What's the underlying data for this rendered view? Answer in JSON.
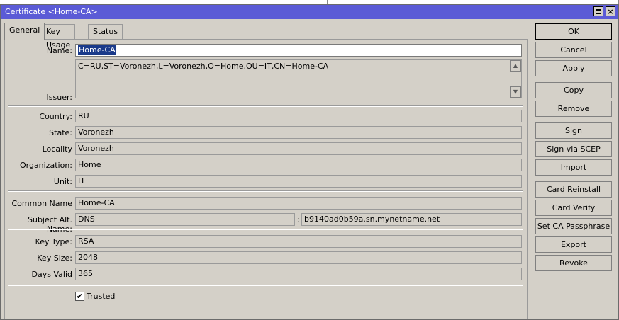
{
  "window": {
    "title": "Certificate <Home-CA>"
  },
  "tabs": [
    {
      "label": "General"
    },
    {
      "label": "Key Usage"
    },
    {
      "label": "Status"
    }
  ],
  "form": {
    "name": {
      "label": "Name:",
      "value": "Home-CA"
    },
    "issuer": {
      "label": "Issuer:",
      "value": "C=RU,ST=Voronezh,L=Voronezh,O=Home,OU=IT,CN=Home-CA"
    },
    "country": {
      "label": "Country:",
      "value": "RU"
    },
    "state": {
      "label": "State:",
      "value": "Voronezh"
    },
    "locality": {
      "label": "Locality",
      "value": "Voronezh"
    },
    "organization": {
      "label": "Organization:",
      "value": "Home"
    },
    "unit": {
      "label": "Unit:",
      "value": "IT"
    },
    "common_name": {
      "label": "Common Name",
      "value": "Home-CA"
    },
    "subject_alt_name": {
      "label": "Subject Alt. Name:",
      "type": "DNS",
      "separator": ":",
      "value": "b9140ad0b59a.sn.mynetname.net"
    },
    "key_type": {
      "label": "Key Type:",
      "value": "RSA"
    },
    "key_size": {
      "label": "Key Size:",
      "value": "2048"
    },
    "days_valid": {
      "label": "Days Valid",
      "value": "365"
    },
    "trusted": {
      "label": "Trusted",
      "checked": true,
      "mark": "✔"
    }
  },
  "buttons": [
    {
      "label": "OK"
    },
    {
      "label": "Cancel"
    },
    {
      "label": "Apply"
    },
    {
      "label": "Copy"
    },
    {
      "label": "Remove"
    },
    {
      "label": "Sign"
    },
    {
      "label": "Sign via SCEP"
    },
    {
      "label": "Import"
    },
    {
      "label": "Card Reinstall"
    },
    {
      "label": "Card Verify"
    },
    {
      "label": "Set CA Passphrase"
    },
    {
      "label": "Export"
    },
    {
      "label": "Revoke"
    }
  ],
  "colors": {
    "titlebar": "#5b5bd6",
    "background": "#d4d0c8",
    "selection": "#1a3a8a"
  }
}
